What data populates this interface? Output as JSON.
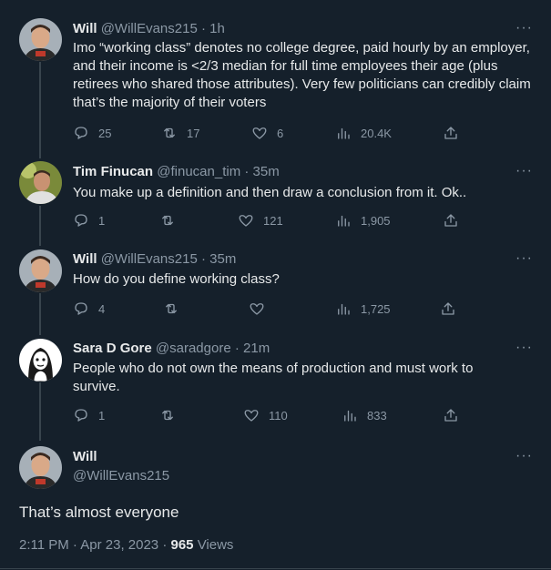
{
  "tweets": [
    {
      "name": "Will",
      "handle": "@WillEvans215",
      "time": "· 1h",
      "text": "Imo “working class” denotes no college degree, paid hourly by an employer, and their income is <2/3 median for full time employees their age (plus retirees who shared those attributes). Very few politicians can credibly claim that’s the majority of their voters",
      "replies": "25",
      "retweets": "17",
      "likes": "6",
      "views": "20.4K"
    },
    {
      "name": "Tim Finucan",
      "handle": "@finucan_tim",
      "time": "· 35m",
      "text": "You make up a definition and then draw a conclusion from it. Ok..",
      "replies": "1",
      "retweets": "",
      "likes": "121",
      "views": "1,905"
    },
    {
      "name": "Will",
      "handle": "@WillEvans215",
      "time": "· 35m",
      "text": "How do you define working class?",
      "replies": "4",
      "retweets": "",
      "likes": "",
      "views": "1,725"
    },
    {
      "name": "Sara D Gore",
      "handle": "@saradgore",
      "time": "· 21m",
      "text": "People who do not own the means of production and must work to survive.",
      "replies": "1",
      "retweets": "",
      "likes": "110",
      "views": "833"
    }
  ],
  "main": {
    "name": "Will",
    "handle": "@WillEvans215",
    "text": "That’s almost everyone",
    "timestamp": "2:11 PM · Apr 23, 2023 ·",
    "views_count": "965",
    "views_label": "Views"
  },
  "more_symbol": "···",
  "icons": {
    "reply": "reply-icon",
    "retweet": "retweet-icon",
    "like": "heart-icon",
    "views": "views-icon",
    "share": "share-icon",
    "more": "more-icon"
  },
  "colors": {
    "background": "#15202b",
    "text": "#e7e9ea",
    "secondary": "#8b98a5",
    "line": "#38444d"
  }
}
